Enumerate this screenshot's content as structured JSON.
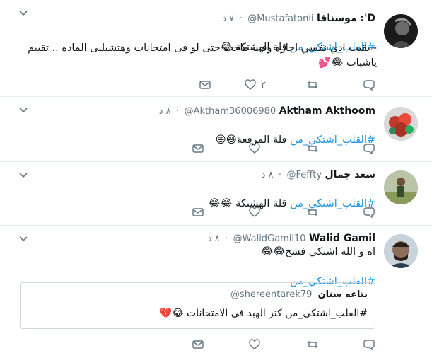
{
  "tweets": [
    {
      "name": "موسنافا :'D",
      "handle": "@Mustafatonii",
      "time": "٧ د",
      "hashtag": "#القلب_اشتكي_من",
      "text_after_hashtag": " قلة الهشتكة 😂",
      "body": "- بقيت ادي نفسي اجازه وقت ماحب حتى لو فى امتحانات وهتشيلنى الماده .. تقييم\nياشباب 😂💕",
      "likes": "٢"
    },
    {
      "name": "Aktham Akthoom",
      "handle": "@Aktham36006980",
      "time": "٨ د",
      "hashtag": "#القلب_اشتكي_من",
      "text_after_hashtag": " قلة المرقعة😄😄",
      "body": "",
      "likes": ""
    },
    {
      "name": "سعد جمال",
      "handle": "@Feffty",
      "time": "٨ د",
      "hashtag": "#القلب_اشتكي_من",
      "text_after_hashtag": " قلة الهشتكة 😂😂",
      "body": "",
      "likes": ""
    },
    {
      "name": "Walid Gamil",
      "handle": "@WalidGamil10",
      "time": "٨ د",
      "line1": "اه و الله اشتكي فشخ😂😂",
      "hashtag": "#القلب_اشتكي_من",
      "quote": {
        "name": "بتاعه سنان",
        "handle": "@shereentarek79",
        "text": "#القلب_اشتكى_من كتر الهبد فى الامتحانات 😂💔"
      },
      "likes": ""
    }
  ],
  "icons": {
    "reply": "reply-icon",
    "retweet": "retweet-icon",
    "like": "heart-icon",
    "dm": "direct-message-icon",
    "more": "chevron-down-icon"
  },
  "colors": {
    "hashtag": "#1b95e0",
    "secondary": "#657786",
    "divider": "#e6ecf0"
  }
}
